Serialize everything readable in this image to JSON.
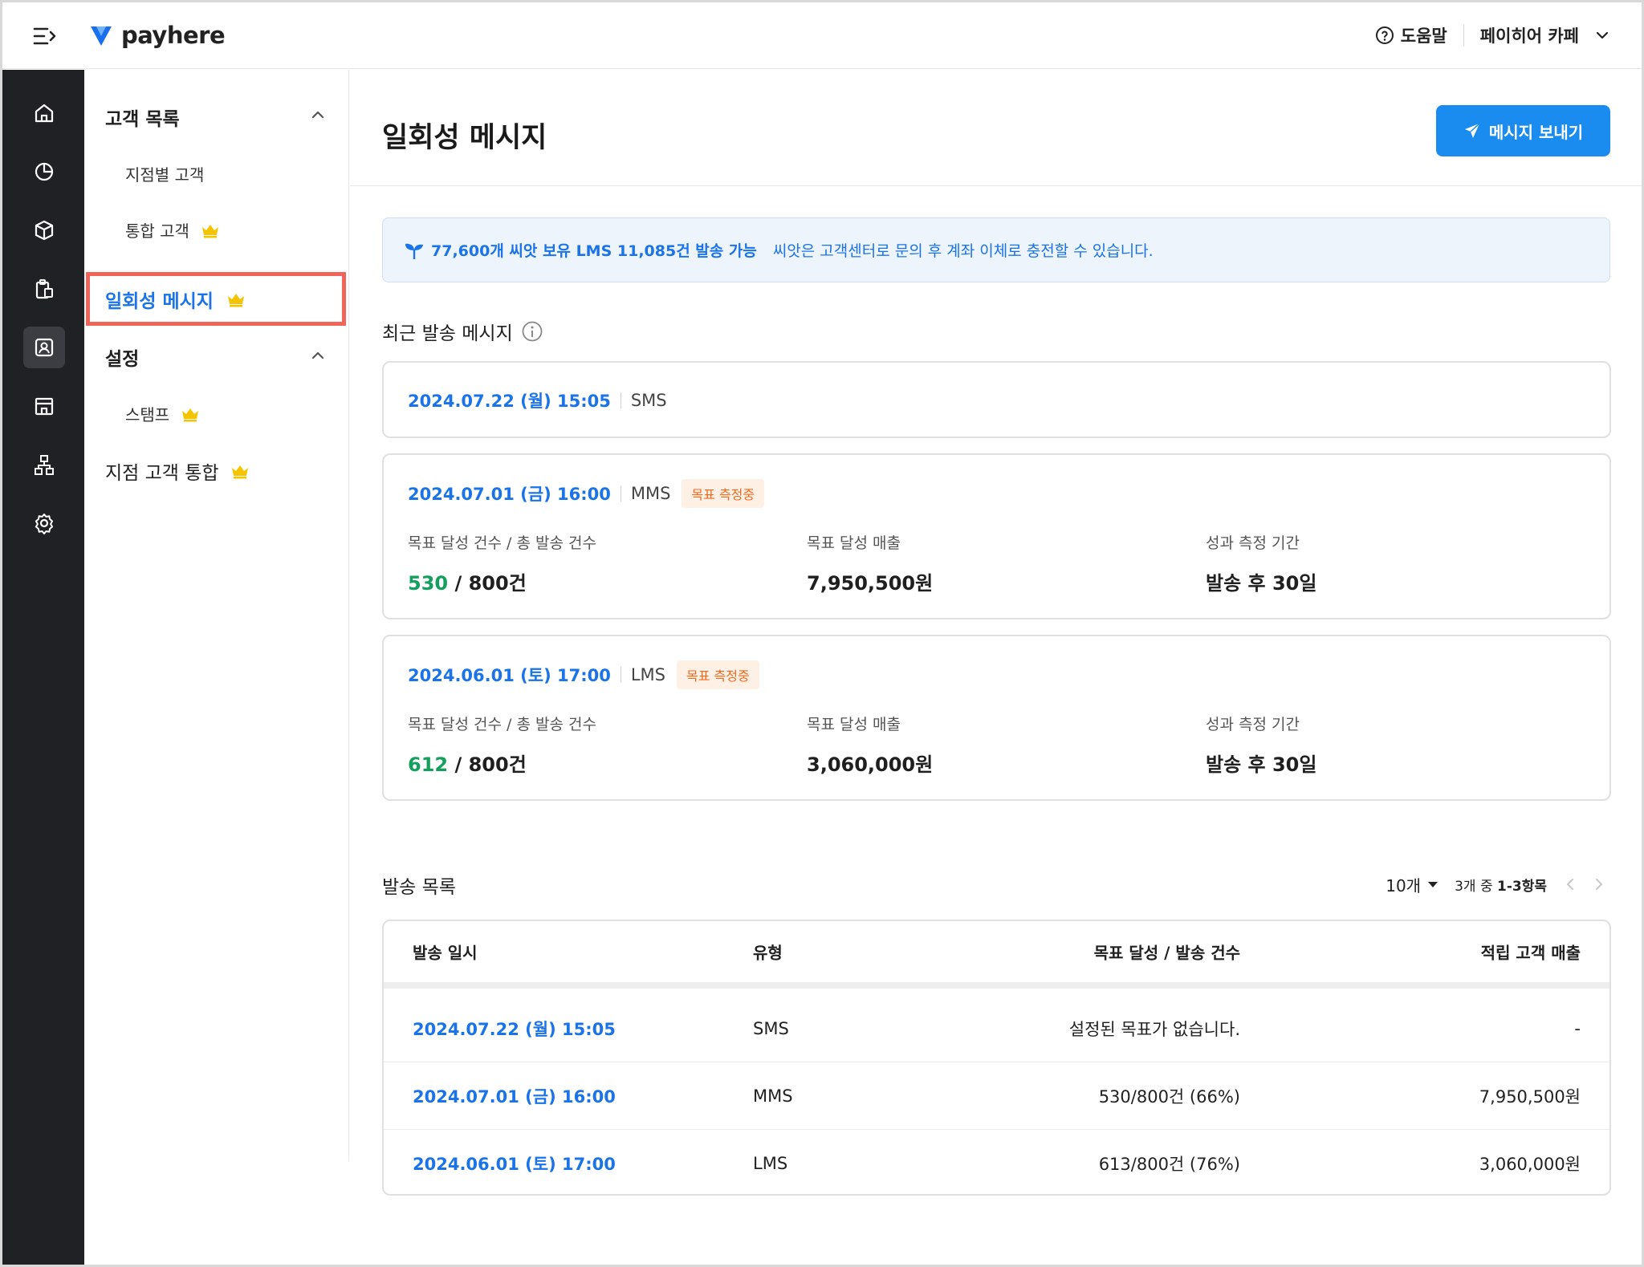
{
  "app": {
    "logo_text": "payhere",
    "brand_color": "#1a8cf0"
  },
  "topbar": {
    "help_label": "도움말",
    "store_name": "페이히어 카페"
  },
  "rail": {
    "items": [
      {
        "name": "home-icon"
      },
      {
        "name": "pie-chart-icon"
      },
      {
        "name": "box-icon"
      },
      {
        "name": "clipboard-icon"
      },
      {
        "name": "customer-icon",
        "active": true
      },
      {
        "name": "store-icon"
      },
      {
        "name": "org-chart-icon"
      },
      {
        "name": "settings-icon"
      }
    ]
  },
  "sidebar": {
    "group_customers": "고객 목록",
    "branch_customers": "지점별 고객",
    "integrated_customers": "통합 고객",
    "one_time_message": "일회성 메시지",
    "group_settings": "설정",
    "stamp": "스탬프",
    "branch_integration": "지점 고객 통합"
  },
  "page": {
    "title": "일회성 메시지",
    "send_button": "메시지 보내기"
  },
  "banner": {
    "main": "77,600개 씨앗 보유 LMS 11,085건 발송 가능",
    "sub": "씨앗은 고객센터로 문의 후 계좌 이체로 충전할 수 있습니다."
  },
  "recent": {
    "title": "최근 발송 메시지",
    "cards": [
      {
        "date": "2024.07.22 (월) 15:05",
        "type": "SMS"
      },
      {
        "date": "2024.07.01 (금) 16:00",
        "type": "MMS",
        "badge": "목표 측정중",
        "label_count": "목표 달성 건수 / 총 발송 건수",
        "achieved": "530",
        "total": "/ 800건",
        "label_sales": "목표 달성 매출",
        "sales": "7,950,500원",
        "label_period": "성과 측정 기간",
        "period": "발송 후 30일"
      },
      {
        "date": "2024.06.01 (토) 17:00",
        "type": "LMS",
        "badge": "목표 측정중",
        "label_count": "목표 달성 건수 / 총 발송 건수",
        "achieved": "612",
        "total": "/ 800건",
        "label_sales": "목표 달성 매출",
        "sales": "3,060,000원",
        "label_period": "성과 측정 기간",
        "period": "발송 후 30일"
      }
    ]
  },
  "history": {
    "title": "발송 목록",
    "per_page": "10개",
    "range_prefix": "3개 중",
    "range": "1-3항목",
    "columns": [
      "발송 일시",
      "유형",
      "목표 달성 / 발송 건수",
      "적립 고객 매출"
    ],
    "rows": [
      {
        "date": "2024.07.22 (월) 15:05",
        "type": "SMS",
        "goal": "설정된 목표가 없습니다.",
        "sales": "-"
      },
      {
        "date": "2024.07.01 (금) 16:00",
        "type": "MMS",
        "goal": "530/800건 (66%)",
        "sales": "7,950,500원"
      },
      {
        "date": "2024.06.01 (토) 17:00",
        "type": "LMS",
        "goal": "613/800건 (76%)",
        "sales": "3,060,000원"
      }
    ]
  }
}
